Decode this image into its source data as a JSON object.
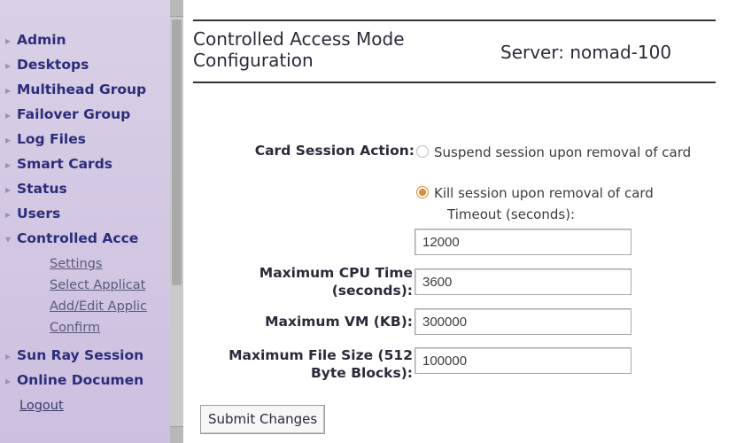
{
  "sidebar": {
    "items": [
      {
        "label": "Admin"
      },
      {
        "label": "Desktops"
      },
      {
        "label": "Multihead Group"
      },
      {
        "label": "Failover Group"
      },
      {
        "label": "Log Files"
      },
      {
        "label": "Smart Cards"
      },
      {
        "label": "Status"
      },
      {
        "label": "Users"
      },
      {
        "label": "Controlled Acce"
      },
      {
        "label": "Sun Ray Session"
      },
      {
        "label": "Online Documen"
      }
    ],
    "subitems": [
      {
        "label": "Settings"
      },
      {
        "label": "Select Applicat"
      },
      {
        "label": "Add/Edit Applic"
      },
      {
        "label": "Confirm"
      }
    ],
    "logout": "Logout"
  },
  "header": {
    "title": "Controlled Access Mode Configuration",
    "server": "Server: nomad-100"
  },
  "form": {
    "card_session": {
      "label": "Card Session Action:",
      "option_suspend": "Suspend session upon removal of card",
      "option_kill": "Kill session upon removal of card",
      "timeout_label": "Timeout (seconds):",
      "selected": "kill"
    },
    "timeout_value": "12000",
    "max_cpu": {
      "label": "Maximum CPU Time (seconds):",
      "value": "3600"
    },
    "max_vm": {
      "label": "Maximum VM (KB):",
      "value": "300000"
    },
    "max_file": {
      "label": "Maximum File Size (512 Byte Blocks):",
      "value": "100000"
    },
    "submit_label": "Submit Changes"
  }
}
